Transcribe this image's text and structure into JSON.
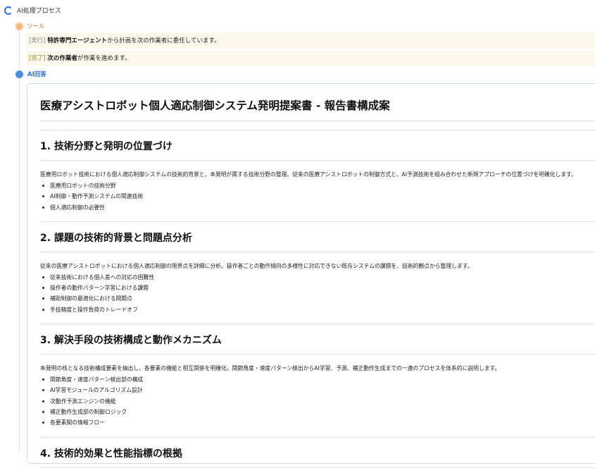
{
  "header": {
    "title": "AI処理プロセス"
  },
  "tool": {
    "label": "ツール",
    "logs": [
      {
        "tag": "[実行]",
        "bold": "特許専門エージェント",
        "text": "から計画を次の作業者に委任しています。"
      },
      {
        "tag": "[完了]",
        "bold": "次の作業者",
        "text": "が作業を進めます。"
      }
    ]
  },
  "answer": {
    "label": "AI回答",
    "title": "医療アシストロボット個人適応制御システム発明提案書 - 報告書構成案",
    "sections": [
      {
        "heading": "1. 技術分野と発明の位置づけ",
        "text": "医療用ロボット技術における個人適応制御システムの技術的背景と、本発明が属する技術分野の整理。従来の医療アシストロボットの制御方式と、AI予測技術を組み合わせた新規アプローチの位置づけを明確化します。",
        "items": [
          "医療用ロボットの技術分野",
          "AI制御・動作予測システムの関連技術",
          "個人適応制御の必要性"
        ]
      },
      {
        "heading": "2. 課題の技術的背景と問題点分析",
        "text": "従来の医療アシストロボットにおける個人適応制御の限界点を詳細に分析。操作者ごとの動作傾向の多様性に対応できない既存システムの課題を、技術的観点から整理します。",
        "items": [
          "従来技術における個人差への対応の困難性",
          "操作者の動作パターン学習における課題",
          "補助制御の最適化における問題点",
          "手技精度と操作負荷のトレードオフ"
        ]
      },
      {
        "heading": "3. 解決手段の技術構成と動作メカニズム",
        "text": "本発明の核となる技術構成要素を抽出し、各要素の機能と相互関係を明確化。関節角度・速度パターン検出からAI学習、予測、補正動作生成までの一連のプロセスを体系的に説明します。",
        "items": [
          "関節角度・速度パターン検出部の構成",
          "AI学習モジュールのアルゴリズム設計",
          "次動作予測エンジンの機能",
          "補正動作生成部の制御ロジック",
          "各要素間の情報フロー"
        ]
      },
      {
        "heading": "4. 技術的効果と性能指標の根拠",
        "text": "",
        "items": []
      }
    ]
  }
}
